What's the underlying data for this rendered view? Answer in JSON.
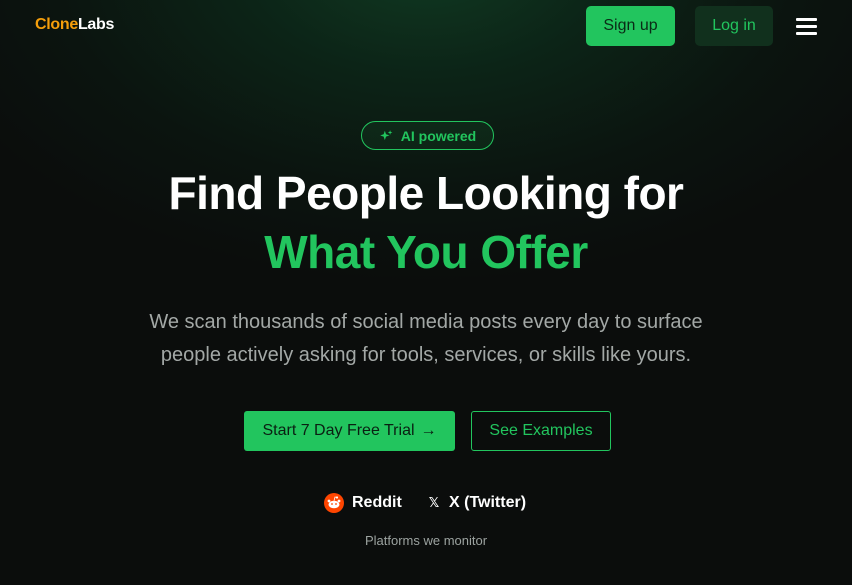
{
  "header": {
    "logo_part1": "Clone",
    "logo_part2": "Labs",
    "signup_label": "Sign up",
    "login_label": "Log in"
  },
  "hero": {
    "badge_label": "AI powered",
    "title_line1": "Find People Looking for",
    "title_line2": "What You Offer",
    "subtitle_line1": "We scan thousands of social media posts every day to surface",
    "subtitle_line2": "people actively asking for tools, services, or skills like yours.",
    "cta_primary": "Start 7 Day Free Trial",
    "cta_primary_arrow": "→",
    "cta_secondary": "See Examples"
  },
  "platforms": {
    "items": [
      {
        "label": "Reddit",
        "icon": "reddit-icon"
      },
      {
        "label": "X (Twitter)",
        "icon": "x-icon"
      }
    ],
    "caption": "Platforms we monitor"
  },
  "colors": {
    "accent": "#22c55e",
    "logo_accent": "#f59e0b",
    "reddit": "#ff4500",
    "background": "#0b0d0c"
  }
}
